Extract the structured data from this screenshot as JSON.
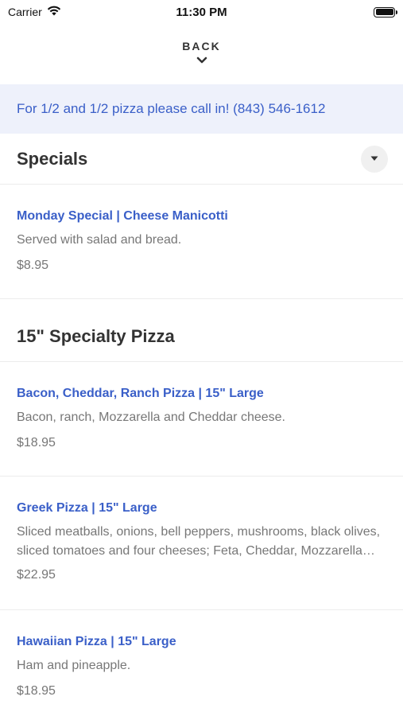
{
  "status_bar": {
    "carrier": "Carrier",
    "time": "11:30 PM"
  },
  "nav": {
    "back_label": "BACK"
  },
  "notice": {
    "text": "For 1/2 and 1/2 pizza please call in! (843) 546-1612"
  },
  "sections": [
    {
      "title": "Specials",
      "items": [
        {
          "name": "Monday Special | Cheese Manicotti",
          "description": "Served with salad and bread.",
          "price": "$8.95"
        }
      ]
    },
    {
      "title": "15\" Specialty Pizza",
      "items": [
        {
          "name": "Bacon, Cheddar, Ranch Pizza | 15\" Large",
          "description": "Bacon, ranch, Mozzarella and Cheddar cheese.",
          "price": "$18.95"
        },
        {
          "name": "Greek Pizza | 15\" Large",
          "description": "Sliced meatballs, onions, bell peppers, mushrooms, black olives, sliced tomatoes and four cheeses; Feta, Cheddar, Mozzarella and Parmesan.",
          "price": "$22.95"
        },
        {
          "name": "Hawaiian Pizza | 15\" Large",
          "description": "Ham and pineapple.",
          "price": "$18.95"
        }
      ]
    }
  ],
  "colors": {
    "accent": "#3a5fc8",
    "notice_bg": "#eef1fb"
  }
}
